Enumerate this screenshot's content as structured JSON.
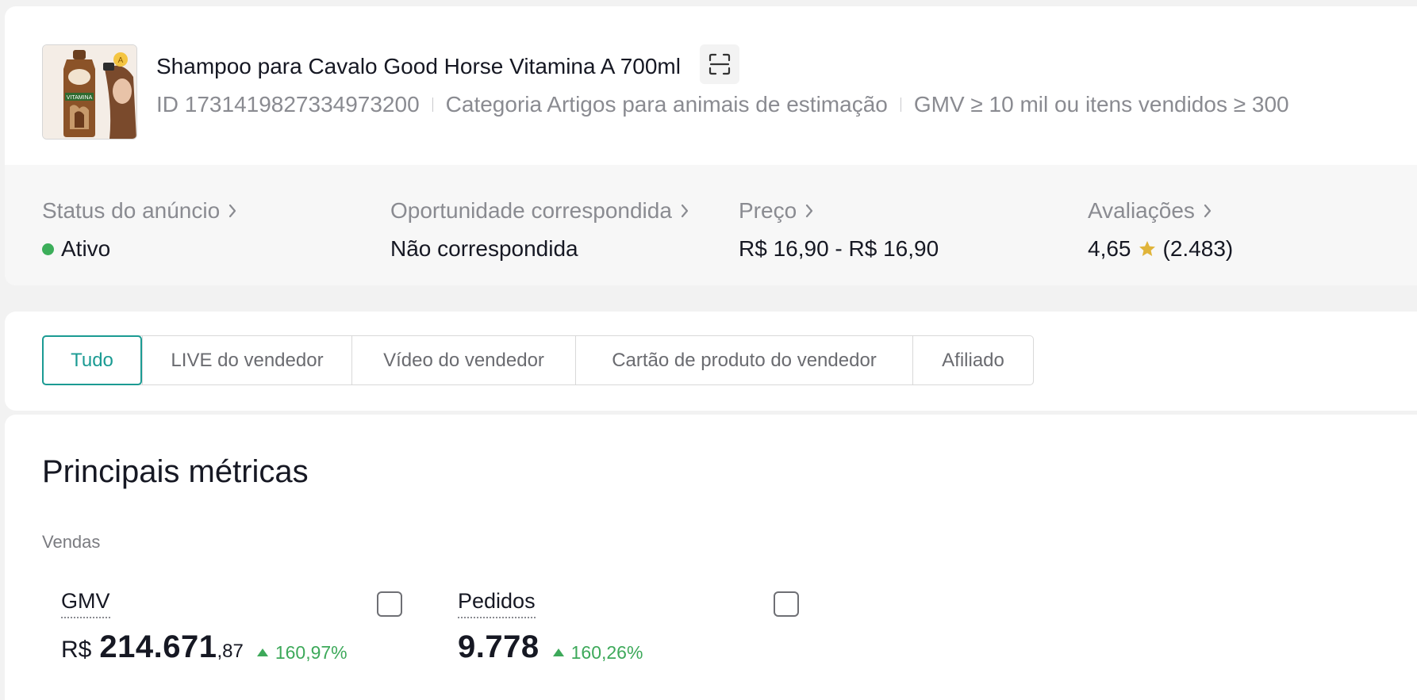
{
  "product": {
    "title": "Shampoo para Cavalo Good Horse Vitamina A 700ml",
    "thumbnail_label": "VITAMINA",
    "id_text": "ID 1731419827334973200",
    "category_text": "Categoria Artigos para animais de estimação",
    "threshold_text": "GMV ≥ 10 mil ou itens vendidos ≥ 300"
  },
  "stats": {
    "status": {
      "label": "Status do anúncio",
      "value": "Ativo",
      "status_color": "#3cae5a"
    },
    "opportunity": {
      "label": "Oportunidade correspondida",
      "value": "Não correspondida"
    },
    "price": {
      "label": "Preço",
      "value": "R$ 16,90 - R$ 16,90"
    },
    "reviews": {
      "label": "Avaliações",
      "rating": "4,65",
      "count": "(2.483)",
      "star_color": "#e0b43a"
    }
  },
  "tabs": [
    {
      "label": "Tudo",
      "active": true
    },
    {
      "label": "LIVE do vendedor",
      "active": false
    },
    {
      "label": "Vídeo do vendedor",
      "active": false
    },
    {
      "label": "Cartão de produto do vendedor",
      "active": false
    },
    {
      "label": "Afiliado",
      "active": false
    }
  ],
  "metrics": {
    "title": "Principais métricas",
    "section": "Vendas",
    "gmv": {
      "label": "GMV",
      "currency": "R$",
      "main": "214.671",
      "decimals": ",87",
      "delta": "160,97%"
    },
    "orders": {
      "label": "Pedidos",
      "main": "9.778",
      "delta": "160,26%"
    }
  },
  "colors": {
    "accent": "#1b9b93",
    "positive": "#3da95a"
  }
}
